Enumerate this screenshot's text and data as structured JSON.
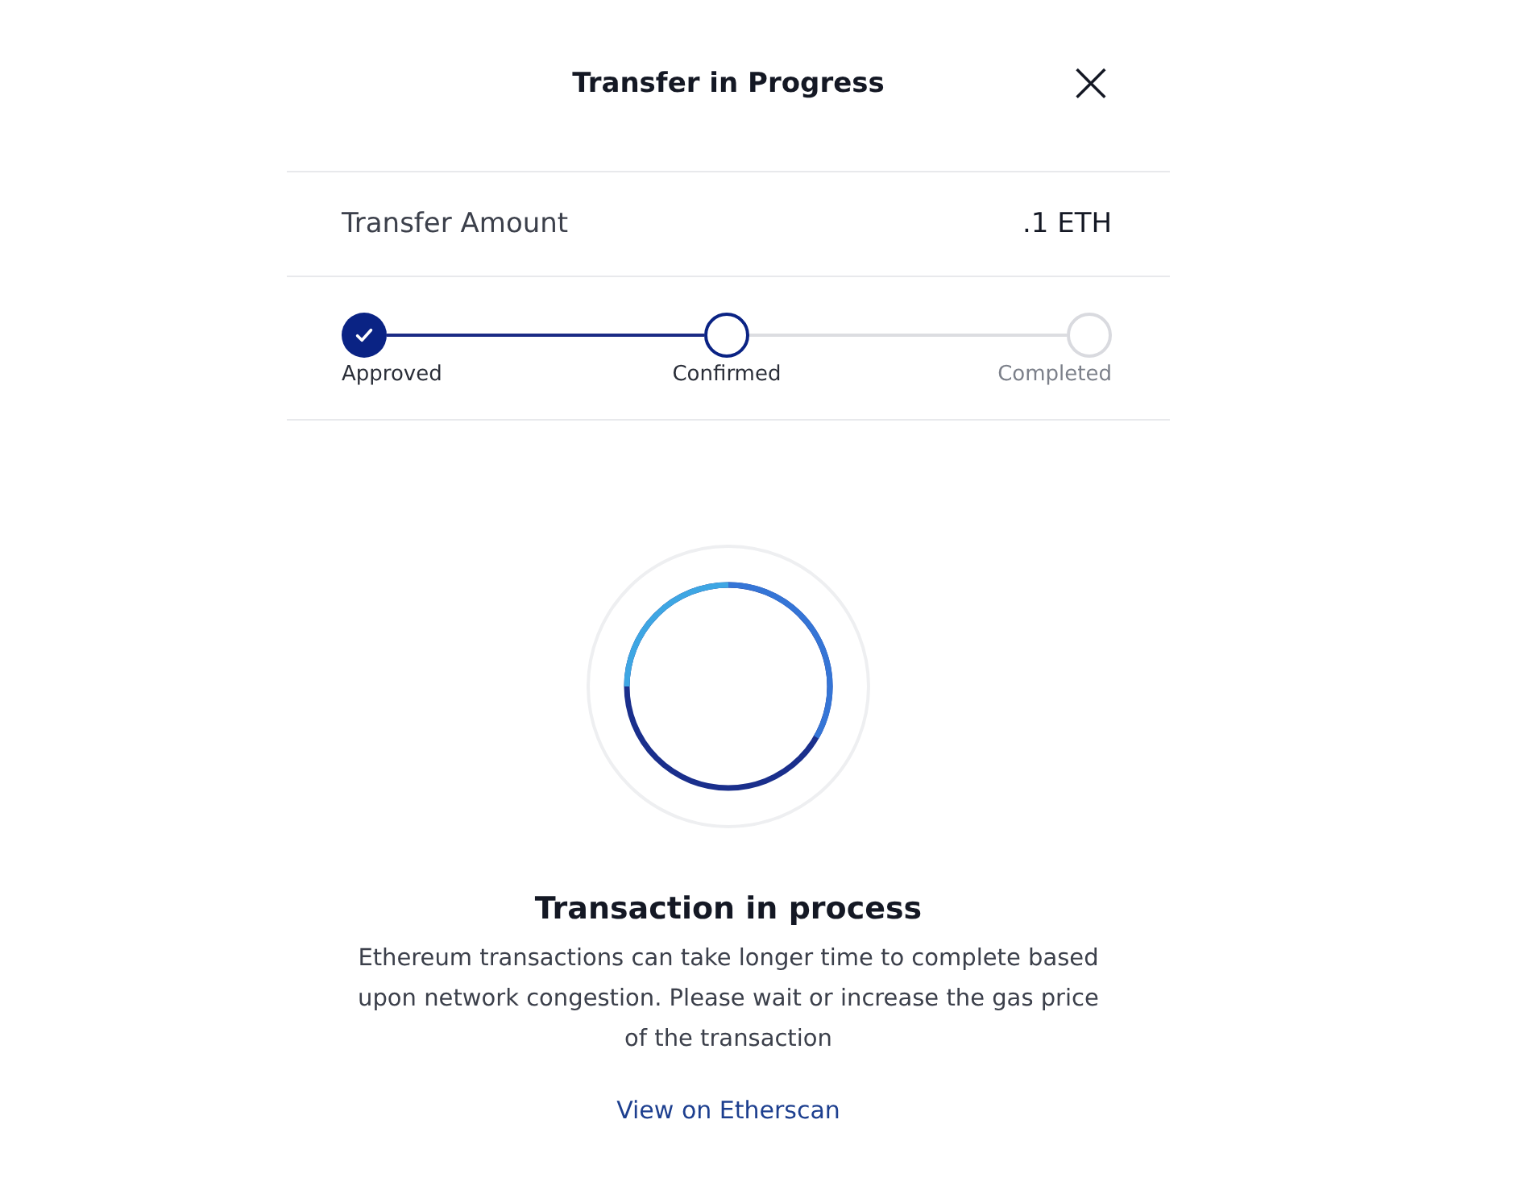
{
  "header": {
    "title": "Transfer in Progress",
    "close": "×"
  },
  "amount": {
    "label": "Transfer Amount",
    "value": ".1 ETH"
  },
  "steps": [
    {
      "label": "Approved",
      "kind": "done"
    },
    {
      "label": "Confirmed",
      "kind": "current"
    },
    {
      "label": "Completed",
      "kind": "pending"
    }
  ],
  "status": {
    "title": "Transaction in process",
    "message": "Ethereum transactions can take longer time to complete based upon network congestion. Please wait or increase the gas price of the transaction",
    "link": "View on Etherscan"
  }
}
